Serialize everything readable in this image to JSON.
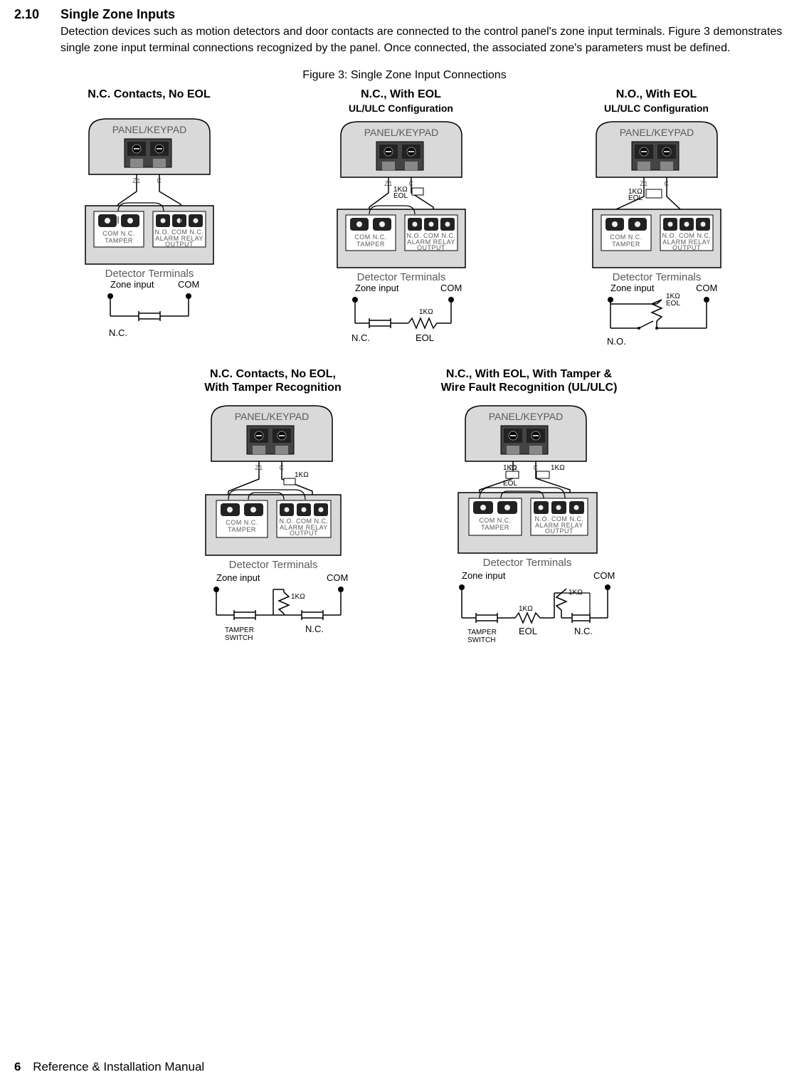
{
  "section": {
    "number": "2.10",
    "title": "Single Zone Inputs",
    "body": "Detection devices such as motion detectors and door contacts are connected to the control panel's zone input terminals. Figure 3 demonstrates single zone input terminal connections recognized by the panel. Once connected, the associated zone's parameters must be defined."
  },
  "figure": {
    "caption": "Figure 3: Single Zone Input Connections"
  },
  "diag": {
    "a": {
      "title": "N.C. Contacts,  No EOL",
      "sub": ""
    },
    "b": {
      "title": "N.C., With EOL",
      "sub": "UL/ULC Configuration"
    },
    "c": {
      "title": "N.O., With EOL",
      "sub": "UL/ULC Configuration"
    },
    "d1": "N.C. Contacts, No EOL,",
    "d2": "With Tamper Recognition",
    "e1": "N.C., With EOL, With Tamper &",
    "e2": "Wire Fault Recognition (UL/ULC)"
  },
  "labels": {
    "panel": "PANEL/KEYPAD",
    "z1": "Z1",
    "c": "C",
    "com_nc": "COM N.C.",
    "tamper": "TAMPER",
    "no_com_nc": "N.O. COM N.C.",
    "alarm_relay": "ALARM RELAY",
    "output": "OUTPUT",
    "det_term": "Detector Terminals",
    "zone_input": "Zone input",
    "com": "COM",
    "nc": "N.C.",
    "no": "N.O.",
    "eol": "EOL",
    "k1": "1KΩ",
    "k1_eol_a": "1KΩ",
    "k1_eol_b": "EOL",
    "tamper_sw1": "TAMPER",
    "tamper_sw2": "SWITCH"
  },
  "footer": {
    "page": "6",
    "text": "Reference & Installation Manual"
  }
}
